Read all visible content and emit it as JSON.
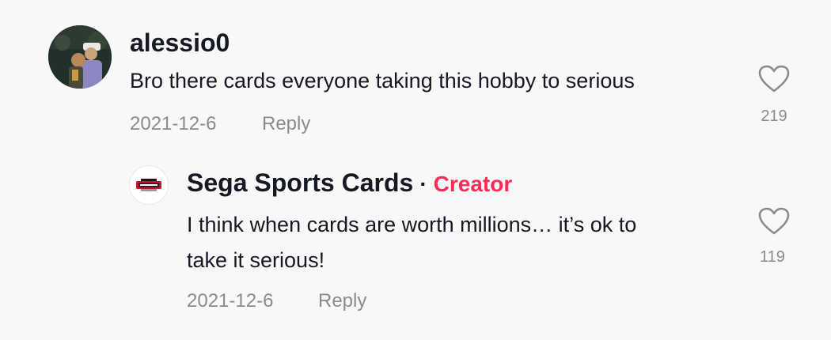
{
  "comments": [
    {
      "username": "alessio0",
      "text": "Bro there cards everyone taking this hobby to serious",
      "date": "2021-12-6",
      "reply_label": "Reply",
      "likes": "219",
      "avatar_icon": "user-photo-avatar"
    }
  ],
  "replies": [
    {
      "username": "Sega Sports Cards",
      "separator": "·",
      "badge": "Creator",
      "text_line1": "I think when cards are worth millions… it’s ok to",
      "text_line2": "take it serious!",
      "date": "2021-12-6",
      "reply_label": "Reply",
      "likes": "119",
      "avatar_icon": "sega-sports-cards-logo"
    }
  ],
  "colors": {
    "background": "#f8f8f8",
    "text": "#161823",
    "muted": "#8a8b91",
    "creator_accent": "#fe2c55"
  }
}
